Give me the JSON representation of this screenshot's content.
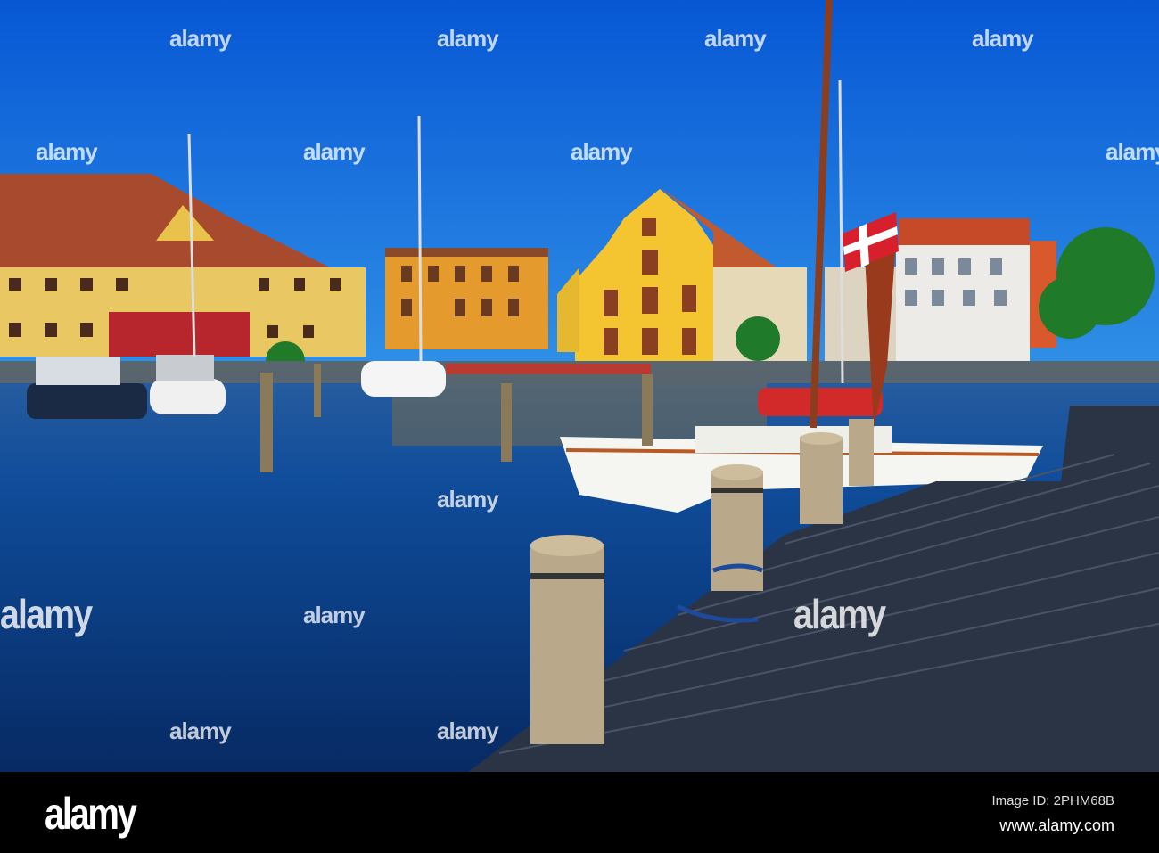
{
  "watermark": {
    "text": "alamy"
  },
  "footer": {
    "logo": "alamy",
    "image_id": "Image ID: 2PHM68B",
    "url": "www.alamy.com"
  },
  "colors": {
    "sky": "#0b5fd8",
    "water": "#0c3f8a",
    "dock": "#2c3444",
    "flag": "#d8202c"
  }
}
